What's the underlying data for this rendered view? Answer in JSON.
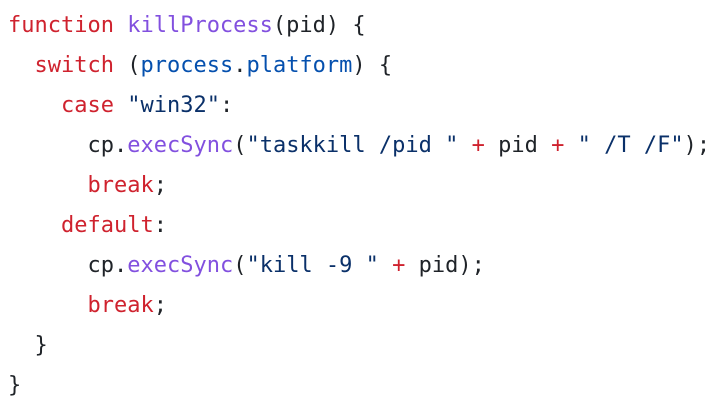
{
  "code": {
    "lines": [
      {
        "indent": "",
        "tokens": [
          {
            "text": "function",
            "type": "keyword"
          },
          {
            "text": " ",
            "type": "plain"
          },
          {
            "text": "killProcess",
            "type": "func"
          },
          {
            "text": "(pid) {",
            "type": "plain"
          }
        ]
      },
      {
        "indent": "  ",
        "tokens": [
          {
            "text": "switch",
            "type": "keyword"
          },
          {
            "text": " (",
            "type": "plain"
          },
          {
            "text": "process",
            "type": "prop"
          },
          {
            "text": ".",
            "type": "plain"
          },
          {
            "text": "platform",
            "type": "prop"
          },
          {
            "text": ") {",
            "type": "plain"
          }
        ]
      },
      {
        "indent": "    ",
        "tokens": [
          {
            "text": "case",
            "type": "keyword"
          },
          {
            "text": " ",
            "type": "plain"
          },
          {
            "text": "\"win32\"",
            "type": "string"
          },
          {
            "text": ":",
            "type": "plain"
          }
        ]
      },
      {
        "indent": "      ",
        "tokens": [
          {
            "text": "cp.",
            "type": "plain"
          },
          {
            "text": "execSync",
            "type": "func"
          },
          {
            "text": "(",
            "type": "plain"
          },
          {
            "text": "\"taskkill /pid \"",
            "type": "string"
          },
          {
            "text": " ",
            "type": "plain"
          },
          {
            "text": "+",
            "type": "op"
          },
          {
            "text": " pid ",
            "type": "plain"
          },
          {
            "text": "+",
            "type": "op"
          },
          {
            "text": " ",
            "type": "plain"
          },
          {
            "text": "\" /T /F\"",
            "type": "string"
          },
          {
            "text": ");",
            "type": "plain"
          }
        ]
      },
      {
        "indent": "      ",
        "tokens": [
          {
            "text": "break",
            "type": "keyword"
          },
          {
            "text": ";",
            "type": "plain"
          }
        ]
      },
      {
        "indent": "    ",
        "tokens": [
          {
            "text": "default",
            "type": "keyword"
          },
          {
            "text": ":",
            "type": "plain"
          }
        ]
      },
      {
        "indent": "      ",
        "tokens": [
          {
            "text": "cp.",
            "type": "plain"
          },
          {
            "text": "execSync",
            "type": "func"
          },
          {
            "text": "(",
            "type": "plain"
          },
          {
            "text": "\"kill -9 \"",
            "type": "string"
          },
          {
            "text": " ",
            "type": "plain"
          },
          {
            "text": "+",
            "type": "op"
          },
          {
            "text": " pid);",
            "type": "plain"
          }
        ]
      },
      {
        "indent": "      ",
        "tokens": [
          {
            "text": "break",
            "type": "keyword"
          },
          {
            "text": ";",
            "type": "plain"
          }
        ]
      },
      {
        "indent": "  ",
        "tokens": [
          {
            "text": "}",
            "type": "plain"
          }
        ]
      },
      {
        "indent": "",
        "tokens": [
          {
            "text": "}",
            "type": "plain"
          }
        ]
      }
    ]
  }
}
